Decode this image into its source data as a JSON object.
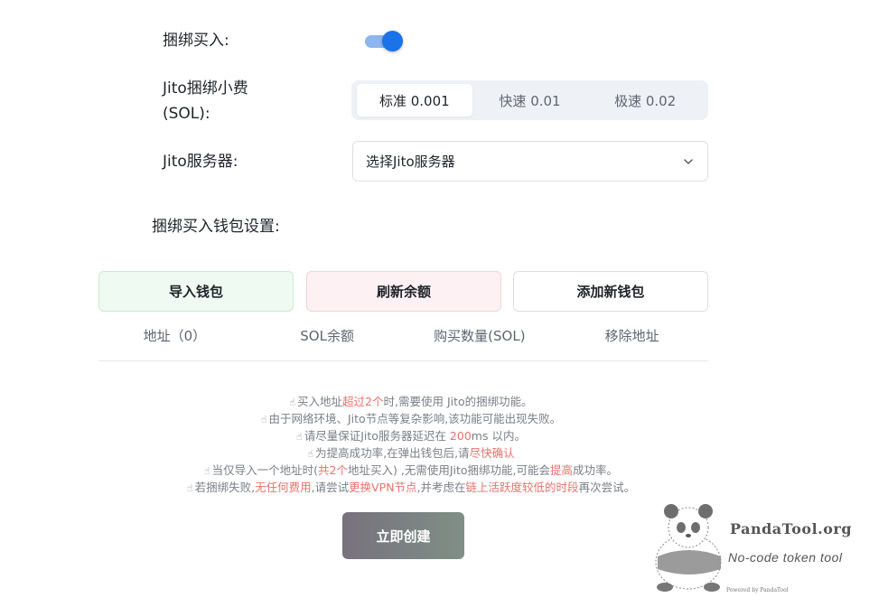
{
  "bundle_buy": {
    "label": "捆绑买入:",
    "enabled": true
  },
  "jito_fee": {
    "label": "Jito捆绑小费(SOL):",
    "options": [
      "标准 0.001",
      "快速 0.01",
      "极速 0.02"
    ],
    "selected": "标准 0.001"
  },
  "jito_server": {
    "label": "Jito服务器:",
    "placeholder": "选择Jito服务器"
  },
  "wallet_settings": {
    "label": "捆绑买入钱包设置:"
  },
  "buttons": {
    "import": "导入钱包",
    "refresh": "刷新余额",
    "add": "添加新钱包"
  },
  "table": {
    "columns": [
      "地址（0）",
      "SOL余额",
      "购买数量(SOL)",
      "移除地址"
    ]
  },
  "tips": [
    [
      {
        "t": "买入地址"
      },
      {
        "t": "超过2个",
        "hl": true
      },
      {
        "t": "时,需要使用 Jito的捆绑功能。"
      }
    ],
    [
      {
        "t": "由于网络环境、Jito节点等复杂影响,该功能可能出现失败。"
      }
    ],
    [
      {
        "t": "请尽量保证Jito服务器延迟在 "
      },
      {
        "t": "200",
        "hl": true
      },
      {
        "t": "ms 以内。"
      }
    ],
    [
      {
        "t": "为提高成功率,在弹出钱包后,请"
      },
      {
        "t": "尽快确认",
        "hl": true
      }
    ],
    [
      {
        "t": "当仅导入一个地址时("
      },
      {
        "t": "共2个",
        "hl": true
      },
      {
        "t": "地址买入) ,无需使用Jito捆绑功能,可能会"
      },
      {
        "t": "提高",
        "hl": true
      },
      {
        "t": "成功率。"
      }
    ],
    [
      {
        "t": "若捆绑失败,"
      },
      {
        "t": "无任何费用",
        "hl": true
      },
      {
        "t": ",请尝试"
      },
      {
        "t": "更换VPN节点",
        "hl": true
      },
      {
        "t": ",并考虑在"
      },
      {
        "t": "链上活跃度较低的时段",
        "hl": true
      },
      {
        "t": "再次尝试。"
      }
    ]
  ],
  "create_button": "立即创建",
  "watermark": {
    "brand": "PandaTool.org",
    "slogan": "No-code token tool",
    "powered": "Powered by PandaTool"
  },
  "colors": {
    "accent": "#1a73e8",
    "highlight": "#e7736c"
  }
}
